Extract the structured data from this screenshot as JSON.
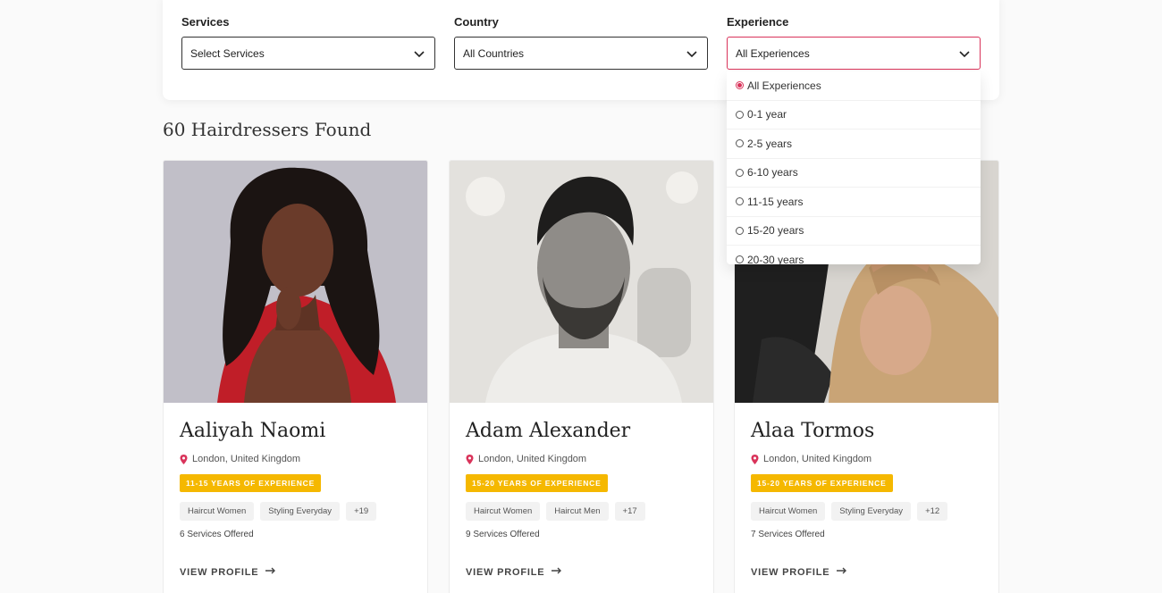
{
  "filters": {
    "services": {
      "label": "Services",
      "value": "Select Services"
    },
    "country": {
      "label": "Country",
      "value": "All Countries"
    },
    "experience": {
      "label": "Experience",
      "value": "All Experiences"
    }
  },
  "experience_dropdown": {
    "options": [
      "All Experiences",
      "0-1 year",
      "2-5 years",
      "6-10 years",
      "11-15 years",
      "15-20 years",
      "20-30 years"
    ],
    "selected_index": 0
  },
  "results": {
    "heading": "60 Hairdressers Found"
  },
  "cards": [
    {
      "name": "Aaliyah Naomi",
      "location": "London, United Kingdom",
      "experience": "11-15 YEARS OF EXPERIENCE",
      "tags": [
        "Haircut Women",
        "Styling Everyday",
        "+19"
      ],
      "services": "6 Services Offered",
      "cta": "VIEW PROFILE"
    },
    {
      "name": "Adam Alexander",
      "location": "London, United Kingdom",
      "experience": "15-20 YEARS OF EXPERIENCE",
      "tags": [
        "Haircut Women",
        "Haircut Men",
        "+17"
      ],
      "services": "9 Services Offered",
      "cta": "VIEW PROFILE"
    },
    {
      "name": "Alaa Tormos",
      "location": "London, United Kingdom",
      "experience": "15-20 YEARS OF EXPERIENCE",
      "tags": [
        "Haircut Women",
        "Styling Everyday",
        "+12"
      ],
      "services": "7 Services Offered",
      "cta": "VIEW PROFILE"
    }
  ],
  "colors": {
    "accent": "#d9335a",
    "badge": "#f5b800",
    "pin": "#d9335a"
  }
}
